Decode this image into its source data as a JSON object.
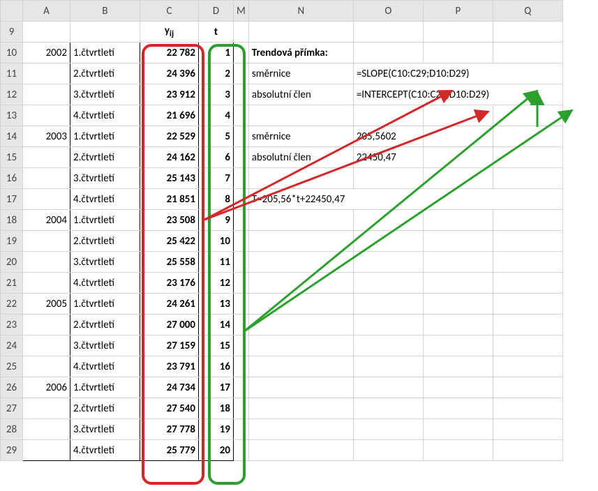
{
  "columns": {
    "A": "A",
    "B": "B",
    "C": "C",
    "D": "D",
    "M": "M",
    "N": "N",
    "O": "O",
    "P": "P",
    "Q": "Q"
  },
  "header9": {
    "C": "yij",
    "D": "t"
  },
  "rows": [
    {
      "r": "10",
      "A": "2002",
      "B": "1.čtvrtletí",
      "C": "22 782",
      "D": "1"
    },
    {
      "r": "11",
      "A": "",
      "B": "2.čtvrtletí",
      "C": "24 396",
      "D": "2"
    },
    {
      "r": "12",
      "A": "",
      "B": "3.čtvrtletí",
      "C": "23 912",
      "D": "3"
    },
    {
      "r": "13",
      "A": "",
      "B": "4.čtvrtletí",
      "C": "21 696",
      "D": "4"
    },
    {
      "r": "14",
      "A": "2003",
      "B": "1.čtvrtletí",
      "C": "22 529",
      "D": "5"
    },
    {
      "r": "15",
      "A": "",
      "B": "2.čtvrtletí",
      "C": "24 162",
      "D": "6"
    },
    {
      "r": "16",
      "A": "",
      "B": "3.čtvrtletí",
      "C": "25 143",
      "D": "7"
    },
    {
      "r": "17",
      "A": "",
      "B": "4.čtvrtletí",
      "C": "21 851",
      "D": "8"
    },
    {
      "r": "18",
      "A": "2004",
      "B": "1.čtvrtletí",
      "C": "23 508",
      "D": "9"
    },
    {
      "r": "19",
      "A": "",
      "B": "2.čtvrtletí",
      "C": "25 422",
      "D": "10"
    },
    {
      "r": "20",
      "A": "",
      "B": "3.čtvrtletí",
      "C": "25 558",
      "D": "11"
    },
    {
      "r": "21",
      "A": "",
      "B": "4.čtvrtletí",
      "C": "23 176",
      "D": "12"
    },
    {
      "r": "22",
      "A": "2005",
      "B": "1.čtvrtletí",
      "C": "24 261",
      "D": "13"
    },
    {
      "r": "23",
      "A": "",
      "B": "2.čtvrtletí",
      "C": "27 000",
      "D": "14"
    },
    {
      "r": "24",
      "A": "",
      "B": "3.čtvrtletí",
      "C": "27 159",
      "D": "15"
    },
    {
      "r": "25",
      "A": "",
      "B": "4.čtvrtletí",
      "C": "23 791",
      "D": "16"
    },
    {
      "r": "26",
      "A": "2006",
      "B": "1.čtvrtletí",
      "C": "24 734",
      "D": "17"
    },
    {
      "r": "27",
      "A": "",
      "B": "2.čtvrtletí",
      "C": "27 540",
      "D": "18"
    },
    {
      "r": "28",
      "A": "",
      "B": "3.čtvrtletí",
      "C": "27 778",
      "D": "19"
    },
    {
      "r": "29",
      "A": "",
      "B": "4.čtvrtletí",
      "C": "25 779",
      "D": "20"
    }
  ],
  "side": {
    "r10_N": "Trendová přímka:",
    "r11_N": "směrnice",
    "r11_O": "=SLOPE(C10:C29;D10:D29)",
    "r12_N": "absolutní člen",
    "r12_O": "=INTERCEPT(C10:C29;D10:D29)",
    "r14_N": "směrnice",
    "r14_O": "205,5602",
    "r15_N": "absolutní člen",
    "r15_O": "22450,47",
    "r17_N": "T=205,56*t+22450,47"
  }
}
